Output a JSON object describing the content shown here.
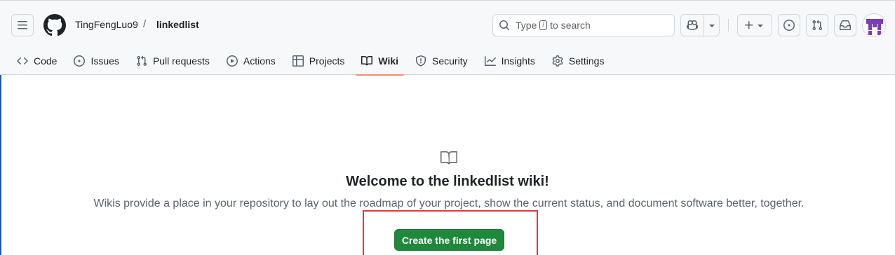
{
  "header": {
    "owner": "TingFengLuo9",
    "separator": "/",
    "repo": "linkedlist",
    "search": {
      "prefix": "Type",
      "key": "/",
      "suffix": "to search"
    },
    "icons": [
      "hamburger-icon",
      "github-logo-icon",
      "search-icon",
      "copilot-icon",
      "triangle-down-icon",
      "plus-icon",
      "issue-opened-icon",
      "git-pull-request-icon",
      "inbox-icon",
      "avatar"
    ]
  },
  "nav": {
    "tabs": [
      {
        "label": "Code",
        "icon": "code-icon",
        "active": false
      },
      {
        "label": "Issues",
        "icon": "issue-opened-icon",
        "active": false
      },
      {
        "label": "Pull requests",
        "icon": "git-pull-request-icon",
        "active": false
      },
      {
        "label": "Actions",
        "icon": "play-icon",
        "active": false
      },
      {
        "label": "Projects",
        "icon": "table-icon",
        "active": false
      },
      {
        "label": "Wiki",
        "icon": "book-icon",
        "active": true
      },
      {
        "label": "Security",
        "icon": "shield-icon",
        "active": false
      },
      {
        "label": "Insights",
        "icon": "graph-icon",
        "active": false
      },
      {
        "label": "Settings",
        "icon": "gear-icon",
        "active": false
      }
    ]
  },
  "main": {
    "heading": "Welcome to the linkedlist wiki!",
    "description": "Wikis provide a place in your repository to lay out the roadmap of your project, show the current status, and document software better, together.",
    "create_button": "Create the first page"
  },
  "colors": {
    "header_bg": "#f6f8fa",
    "active_underline": "#fd8c73",
    "primary_button": "#1f883d",
    "highlight_box": "#e5383b",
    "avatar_purple": "#7b3fb0"
  }
}
